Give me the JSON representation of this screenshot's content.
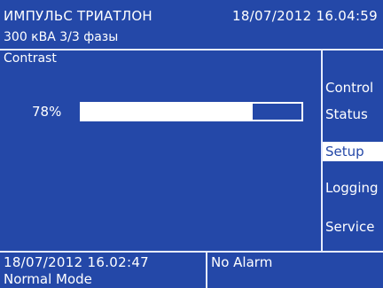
{
  "header": {
    "device_name": "ИМПУЛЬС ТРИАТЛОН",
    "datetime": "18/07/2012 16.04:59",
    "spec": "300 кВА  3/3 фазы"
  },
  "panel": {
    "title": "Contrast",
    "contrast_label": "78%",
    "contrast_value": 0.78
  },
  "menu": {
    "items": [
      {
        "label": "Control",
        "selected": false
      },
      {
        "label": "Status",
        "selected": false
      },
      {
        "label": "Setup",
        "selected": true
      },
      {
        "label": "Logging",
        "selected": false
      },
      {
        "label": "Service",
        "selected": false
      }
    ]
  },
  "status": {
    "datetime": "18/07/2012  16.02:47",
    "mode": "Normal Mode",
    "alarm": "No Alarm"
  },
  "colors": {
    "background": "#2448a8",
    "foreground": "#ffffff"
  }
}
